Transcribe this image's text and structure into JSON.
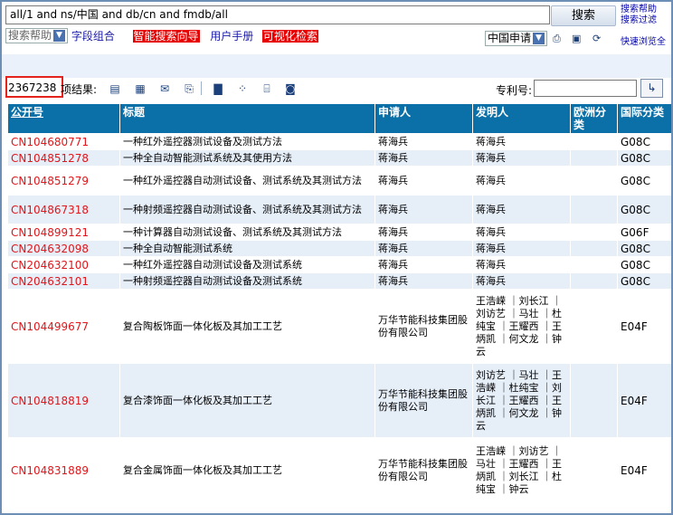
{
  "search": {
    "query": "all/1 and ns/中国  and db/cn and fmdb/all",
    "button": "搜索"
  },
  "side_links": [
    "搜索帮助",
    "搜索过滤",
    "快速浏览全"
  ],
  "options": {
    "help_select": "搜索帮助",
    "field_combo": "字段组合",
    "smart_search": "智能搜索向导",
    "user_manual": "用户手册",
    "visual_search": "可视化检索",
    "db_select": "中国申请"
  },
  "toolbar": {
    "count": "2367238",
    "result_suffix": "项结果:",
    "patent_no_label": "专利号:",
    "patent_no_value": ""
  },
  "table": {
    "columns": [
      "公开号",
      "标题",
      "申请人",
      "发明人",
      "欧洲分类",
      "国际分类"
    ],
    "rows": [
      {
        "pub": "CN104680771",
        "title": "一种红外遥控器测试设备及测试方法",
        "applicant": "蒋海兵",
        "inventor": "蒋海兵",
        "ecla": "",
        "ipc": "G08C"
      },
      {
        "pub": "CN104851278",
        "title": "一种全自动智能测试系统及其使用方法",
        "applicant": "蒋海兵",
        "inventor": "蒋海兵",
        "ecla": "",
        "ipc": "G08C"
      },
      {
        "pub": "CN104851279",
        "title": "一种红外遥控器自动测试设备、测试系统及其测试方法",
        "applicant": "蒋海兵",
        "inventor": "蒋海兵",
        "ecla": "",
        "ipc": "G08C"
      },
      {
        "pub": "CN104867318",
        "title": "一种射频遥控器自动测试设备、测试系统及其测试方法",
        "applicant": "蒋海兵",
        "inventor": "蒋海兵",
        "ecla": "",
        "ipc": "G08C"
      },
      {
        "pub": "CN104899121",
        "title": "一种计算器自动测试设备、测试系统及其测试方法",
        "applicant": "蒋海兵",
        "inventor": "蒋海兵",
        "ecla": "",
        "ipc": "G06F"
      },
      {
        "pub": "CN204632098",
        "title": "一种全自动智能测试系统",
        "applicant": "蒋海兵",
        "inventor": "蒋海兵",
        "ecla": "",
        "ipc": "G08C"
      },
      {
        "pub": "CN204632100",
        "title": "一种红外遥控器自动测试设备及测试系统",
        "applicant": "蒋海兵",
        "inventor": "蒋海兵",
        "ecla": "",
        "ipc": "G08C"
      },
      {
        "pub": "CN204632101",
        "title": "一种射频遥控器自动测试设备及测试系统",
        "applicant": "蒋海兵",
        "inventor": "蒋海兵",
        "ecla": "",
        "ipc": "G08C"
      },
      {
        "pub": "CN104499677",
        "title": "复合陶板饰面一体化板及其加工工艺",
        "applicant": "万华节能科技集团股份有限公司",
        "inventor": "王浩嵘 ｜刘长江 ｜刘访艺 ｜马壮 ｜杜纯宝 ｜王耀西 ｜王炳凯 ｜何文龙 ｜钟云",
        "ecla": "",
        "ipc": "E04F"
      },
      {
        "pub": "CN104818819",
        "title": "复合漆饰面一体化板及其加工工艺",
        "applicant": "万华节能科技集团股份有限公司",
        "inventor": "刘访艺 ｜马壮 ｜王浩嵘 ｜杜纯宝 ｜刘长江 ｜王耀西 ｜王炳凯 ｜何文龙 ｜钟云",
        "ecla": "",
        "ipc": "E04F"
      },
      {
        "pub": "CN104831889",
        "title": "复合金属饰面一体化板及其加工工艺",
        "applicant": "万华节能科技集团股份有限公司",
        "inventor": "王浩嵘 ｜刘访艺 ｜马壮 ｜王耀西 ｜王炳凯 ｜刘长江 ｜杜纯宝 ｜钟云",
        "ecla": "",
        "ipc": "E04F"
      }
    ]
  }
}
